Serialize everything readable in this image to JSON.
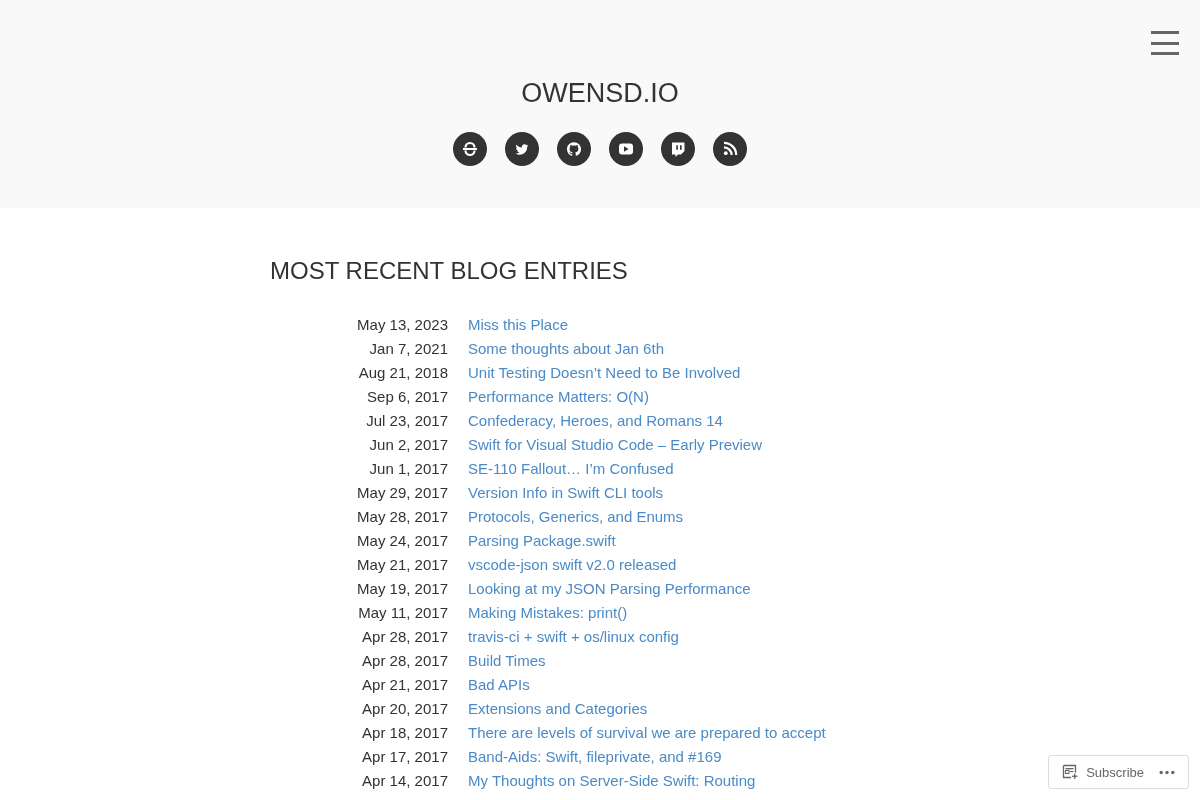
{
  "site": {
    "title": "OWENSD.IO"
  },
  "social_links": [
    {
      "kind": "arcs"
    },
    {
      "kind": "bird"
    },
    {
      "kind": "octocat"
    },
    {
      "kind": "play"
    },
    {
      "kind": "chat"
    },
    {
      "kind": "rss"
    }
  ],
  "section": {
    "heading": "MOST RECENT BLOG ENTRIES"
  },
  "entries": [
    {
      "date": "May 13, 2023",
      "title": "Miss this Place"
    },
    {
      "date": "Jan 7, 2021",
      "title": "Some thoughts about Jan 6th"
    },
    {
      "date": "Aug 21, 2018",
      "title": "Unit Testing Doesn’t Need to Be Involved"
    },
    {
      "date": "Sep 6, 2017",
      "title": "Performance Matters: O(N)"
    },
    {
      "date": "Jul 23, 2017",
      "title": "Confederacy, Heroes, and Romans 14"
    },
    {
      "date": "Jun 2, 2017",
      "title": "Swift for Visual Studio Code – Early Preview"
    },
    {
      "date": "Jun 1, 2017",
      "title": "SE-110 Fallout… I’m Confused"
    },
    {
      "date": "May 29, 2017",
      "title": "Version Info in Swift CLI tools"
    },
    {
      "date": "May 28, 2017",
      "title": "Protocols, Generics, and Enums"
    },
    {
      "date": "May 24, 2017",
      "title": "Parsing Package.swift"
    },
    {
      "date": "May 21, 2017",
      "title": "vscode-json swift v2.0 released"
    },
    {
      "date": "May 19, 2017",
      "title": "Looking at my JSON Parsing Performance"
    },
    {
      "date": "May 11, 2017",
      "title": "Making Mistakes: print()"
    },
    {
      "date": "Apr 28, 2017",
      "title": "travis-ci + swift + os/linux config"
    },
    {
      "date": "Apr 28, 2017",
      "title": "Build Times"
    },
    {
      "date": "Apr 21, 2017",
      "title": "Bad APIs"
    },
    {
      "date": "Apr 20, 2017",
      "title": "Extensions and Categories"
    },
    {
      "date": "Apr 18, 2017",
      "title": "There are levels of survival we are prepared to accept"
    },
    {
      "date": "Apr 17, 2017",
      "title": "Band-Aids: Swift, fileprivate, and #169"
    },
    {
      "date": "Apr 14, 2017",
      "title": "My Thoughts on Server-Side Swift: Routing"
    }
  ],
  "subscribe_bar": {
    "label": "Subscribe"
  }
}
